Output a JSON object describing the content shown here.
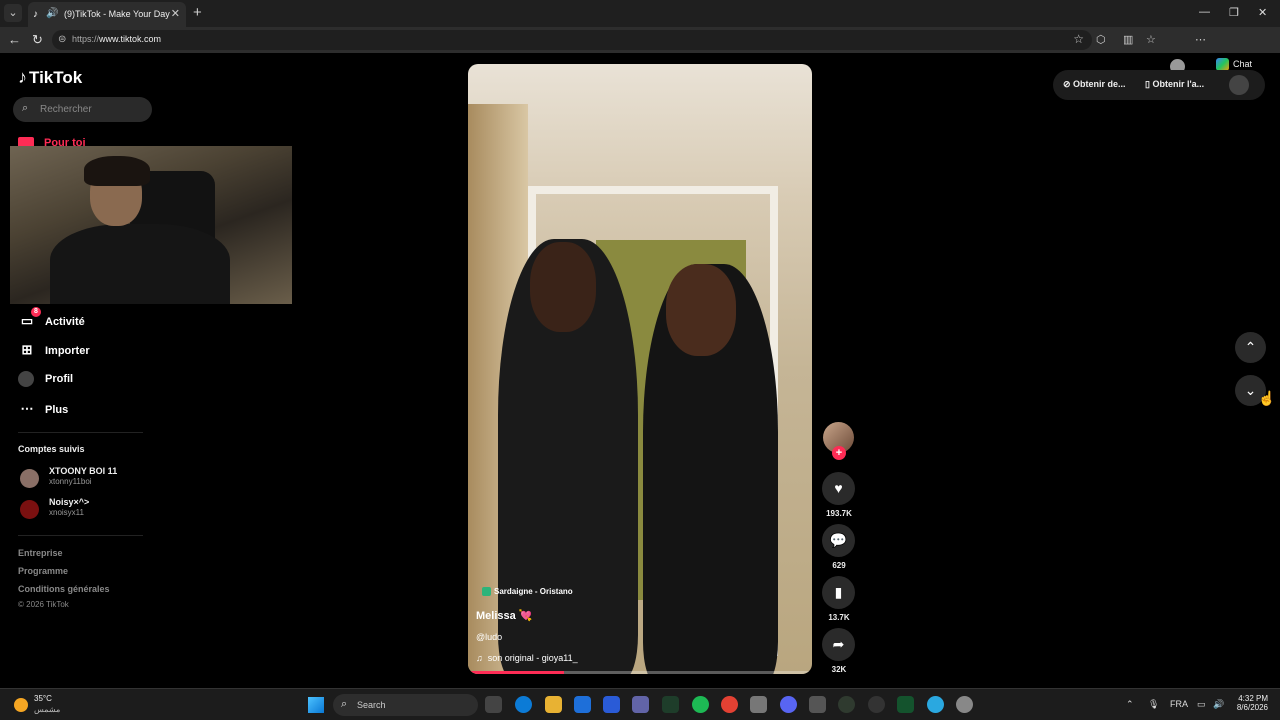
{
  "browser": {
    "tab_title": "(9)TikTok - Make Your Day",
    "url_prefix": "https://",
    "url_domain": "www.tiktok.com",
    "chat_label": "Chat"
  },
  "sidebar": {
    "logo": "TikTok",
    "search_placeholder": "Rechercher",
    "for_you": "Pour toi",
    "items": [
      {
        "label": "Activité",
        "badge": "8"
      },
      {
        "label": "Importer"
      },
      {
        "label": "Profil"
      },
      {
        "label": "Plus"
      }
    ],
    "following_title": "Comptes suivis",
    "following": [
      {
        "name": "XTOONY BOI 11",
        "handle": "xtonny11boi"
      },
      {
        "name": "Noisy×^>",
        "handle": "xnoisyx11"
      }
    ],
    "footer": [
      "Entreprise",
      "Programme",
      "Conditions générales"
    ],
    "copyright": "© 2026 TikTok"
  },
  "video": {
    "location": "Sardaigne - Oristano",
    "author": "Melissa 💘",
    "handle": "@ludo",
    "sound": "son original - gioya11_",
    "progress": 0.28
  },
  "actions": {
    "likes": "193.7K",
    "comments": "629",
    "saves": "13.7K",
    "shares": "32K"
  },
  "header": {
    "btn1": "Obtenir de...",
    "btn2": "Obtenir l'a..."
  },
  "taskbar": {
    "temp": "35°C",
    "weather_desc": "مشمس",
    "search": "Search",
    "lang": "FRA",
    "time": "4:32 PM",
    "date": "8/6/2026"
  }
}
